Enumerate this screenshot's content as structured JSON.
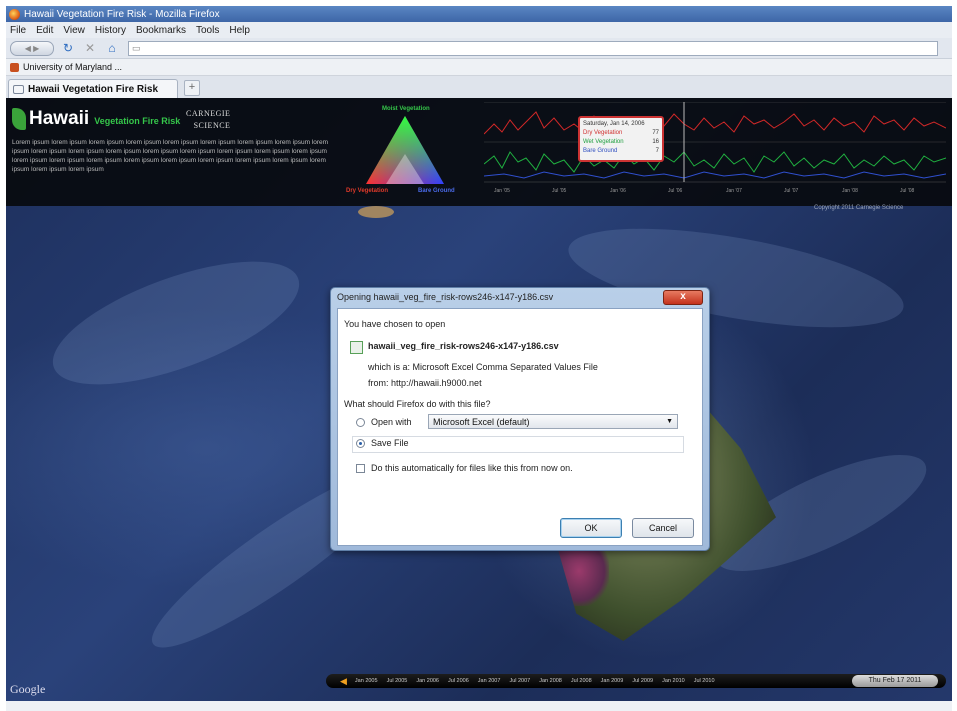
{
  "window": {
    "title": "Hawaii Vegetation Fire Risk - Mozilla Firefox"
  },
  "menu": [
    "File",
    "Edit",
    "View",
    "History",
    "Bookmarks",
    "Tools",
    "Help"
  ],
  "nav": {
    "url": ""
  },
  "bookmarks": [
    {
      "label": "University of Maryland ..."
    }
  ],
  "tabs": [
    {
      "label": "Hawaii Vegetation Fire Risk"
    }
  ],
  "header": {
    "logo_main": "Hawaii",
    "logo_sub": "Vegetation Fire Risk",
    "partner_line1": "CARNEGIE",
    "partner_line2": "SCIENCE",
    "lorem": "Lorem ipsum lorem ipsum lorem ipsum lorem ipsum lorem ipsum lorem ipsum lorem ipsum lorem ipsum lorem ipsum lorem ipsum lorem ipsum lorem ipsum lorem ipsum lorem ipsum lorem ipsum lorem ipsum lorem ipsum lorem ipsum lorem ipsum lorem ipsum lorem ipsum lorem ipsum lorem ipsum lorem ipsum lorem ipsum lorem ipsum lorem ipsum lorem ipsum",
    "triangle_top": "Moist Vegetation",
    "triangle_left": "Dry Vegetation",
    "triangle_right": "Bare Ground"
  },
  "chart_tooltip": {
    "date": "Saturday, Jan 14, 2006",
    "rows": [
      {
        "label": "Dry Vegetation",
        "value": "77",
        "color": "#d03030"
      },
      {
        "label": "Wet Vegetation",
        "value": "16",
        "color": "#20a040"
      },
      {
        "label": "Bare Ground",
        "value": "7",
        "color": "#3050c0"
      }
    ]
  },
  "chart_ticks": [
    "Jan '05",
    "Jul '05",
    "Jan '06",
    "Jul '06",
    "Jan '07",
    "Jul '07",
    "Jan '08",
    "Jul '08"
  ],
  "copyright": "Copyright 2011 Carnegie Science",
  "timeline": {
    "ticks": [
      "Jan 2005",
      "Jul 2005",
      "Jan 2006",
      "Jul 2006",
      "Jan 2007",
      "Jul 2007",
      "Jan 2008",
      "Jul 2008",
      "Jan 2009",
      "Jul 2009",
      "Jan 2010",
      "Jul 2010"
    ],
    "current": "Thu Feb 17 2011"
  },
  "map": {
    "attribution": "Google"
  },
  "dialog": {
    "title": "Opening hawaii_veg_fire_risk-rows246-x147-y186.csv",
    "close_label": "x",
    "chosen_to_open": "You have chosen to open",
    "filename": "hawaii_veg_fire_risk-rows246-x147-y186.csv",
    "which_is": "which is a:  Microsoft Excel Comma Separated Values File",
    "from": "from:  http://hawaii.h9000.net",
    "question": "What should Firefox do with this file?",
    "open_with_label": "Open with",
    "open_with_value": "Microsoft Excel (default)",
    "save_file_label": "Save File",
    "auto_label": "Do this automatically for files like this from now on.",
    "ok_label": "OK",
    "cancel_label": "Cancel",
    "selected_option": "save"
  }
}
